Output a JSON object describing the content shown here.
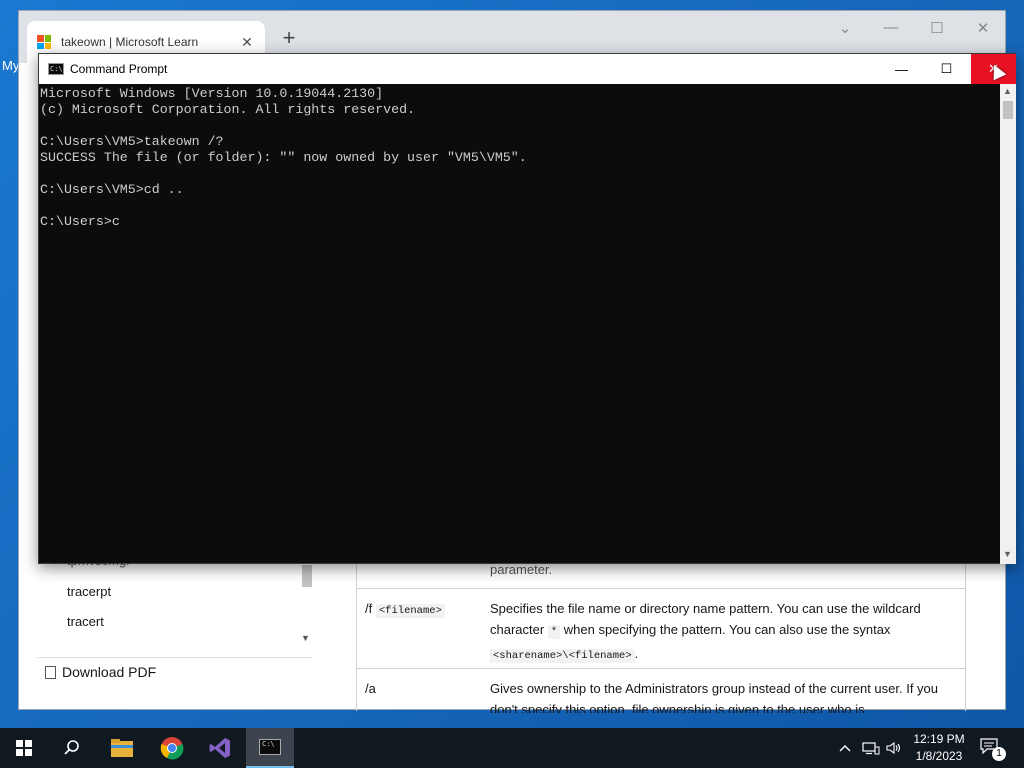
{
  "desktop": {
    "label": "My"
  },
  "browser": {
    "tab_title": "takeown | Microsoft Learn",
    "tab_close": "✕",
    "new_tab": "+",
    "controls": {
      "dropdown": "⌄",
      "minimize": "—",
      "maximize": "☐",
      "close": "✕"
    },
    "toc": {
      "items": [
        "tpmvscmgr",
        "tracerpt",
        "tracert"
      ],
      "download_pdf": "Download PDF"
    },
    "param_table": {
      "rows": [
        {
          "name": "",
          "desc": "parameter."
        },
        {
          "name": "/f",
          "name_code": "<filename>",
          "desc_1": "Specifies the file name or directory name pattern. You can use the wildcard character",
          "desc_code_1": "*",
          "desc_2": "when specifying the pattern. You can also use the syntax",
          "desc_code_2": "<sharename>\\<filename>",
          "desc_3": "."
        },
        {
          "name": "/a",
          "desc": "Gives ownership to the Administrators group instead of the current user. If you don't specify this option, file ownership is given to the user who is"
        }
      ]
    }
  },
  "cmd": {
    "title": "Command Prompt",
    "icon_text": "C:\\",
    "controls": {
      "minimize": "—",
      "maximize": "☐",
      "close": "✕"
    },
    "lines": [
      "Microsoft Windows [Version 10.0.19044.2130]",
      "(c) Microsoft Corporation. All rights reserved.",
      "",
      "C:\\Users\\VM5>takeown /?",
      "SUCCESS The file (or folder): \"\" now owned by user \"VM5\\VM5\".",
      "",
      "C:\\Users\\VM5>cd ..",
      "",
      "C:\\Users>c"
    ]
  },
  "taskbar": {
    "apps": [
      "start-icon",
      "search-icon",
      "file-explorer-icon",
      "chrome-icon",
      "visual-studio-icon",
      "command-prompt-icon"
    ],
    "time": "12:19 PM",
    "date": "1/8/2023",
    "notification_count": "1"
  },
  "colors": {
    "desktop": "#1b78d0",
    "close_red": "#e81123",
    "console_bg": "#0c0c0c",
    "console_fg": "#cccccc",
    "taskbar": "#101820"
  }
}
